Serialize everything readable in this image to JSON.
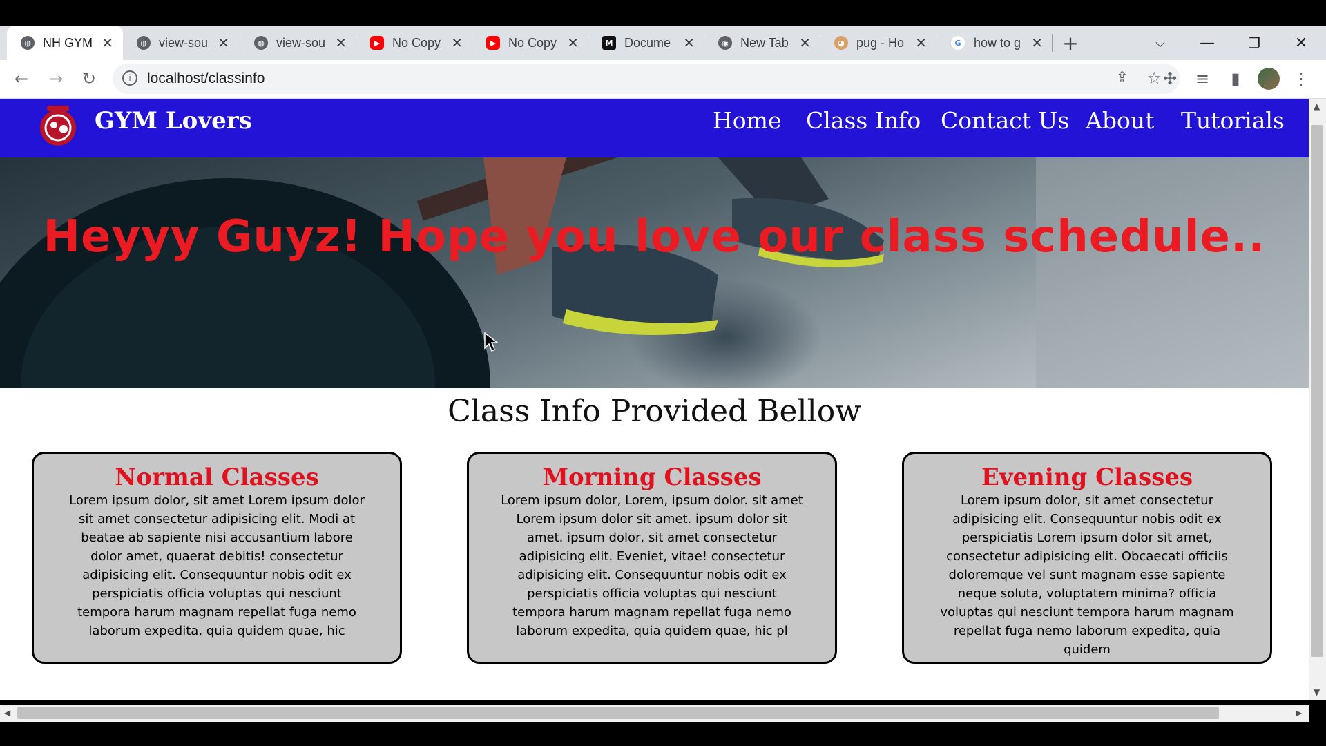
{
  "browser": {
    "tabs": [
      {
        "title": "NH GYM",
        "favicon": "globe-icon",
        "active": true
      },
      {
        "title": "view-sou",
        "favicon": "globe-icon"
      },
      {
        "title": "view-sou",
        "favicon": "globe-icon"
      },
      {
        "title": "No Copy",
        "favicon": "youtube-icon"
      },
      {
        "title": "No Copy",
        "favicon": "youtube-icon"
      },
      {
        "title": "Docume",
        "favicon": "m-icon"
      },
      {
        "title": "New Tab",
        "favicon": "chrome-icon"
      },
      {
        "title": "pug - Ho",
        "favicon": "pug-icon"
      },
      {
        "title": "how to g",
        "favicon": "google-icon"
      }
    ],
    "url": "localhost/classinfo"
  },
  "site": {
    "brand": "GYM Lovers",
    "nav": [
      "Home",
      "Class Info",
      "Contact Us",
      "About",
      "Tutorials"
    ],
    "hero_text": "Heyyy Guyz! Hope you love our class schedule..",
    "section_title": "Class Info Provided Bellow",
    "cards": [
      {
        "title": "Normal Classes",
        "body": "Lorem ipsum dolor, sit amet Lorem ipsum dolor sit amet consectetur adipisicing elit. Modi at beatae ab sapiente nisi accusantium labore dolor amet, quaerat debitis! consectetur adipisicing elit. Consequuntur nobis odit ex perspiciatis officia voluptas qui nesciunt tempora harum magnam repellat fuga nemo laborum expedita, quia quidem quae, hic"
      },
      {
        "title": "Morning Classes",
        "body": "Lorem ipsum dolor, Lorem, ipsum dolor. sit amet Lorem ipsum dolor sit amet. ipsum dolor sit amet. ipsum dolor, sit amet consectetur adipisicing elit. Eveniet, vitae! consectetur adipisicing elit. Consequuntur nobis odit ex perspiciatis officia voluptas qui nesciunt tempora harum magnam repellat fuga nemo laborum expedita, quia quidem quae, hic pl"
      },
      {
        "title": "Evening Classes",
        "body": "Lorem ipsum dolor, sit amet consectetur adipisicing elit. Consequuntur nobis odit ex perspiciatis Lorem ipsum dolor sit amet, consectetur adipisicing elit. Obcaecati officiis doloremque vel sunt magnam esse sapiente neque soluta, voluptatem minima? officia voluptas qui nesciunt tempora harum magnam repellat fuga nemo laborum expedita, quia quidem"
      }
    ]
  },
  "colors": {
    "navbar": "#2213d6",
    "hero_text": "#ea1b22",
    "card_title": "#e0121f",
    "card_bg": "#c7c7c7"
  }
}
